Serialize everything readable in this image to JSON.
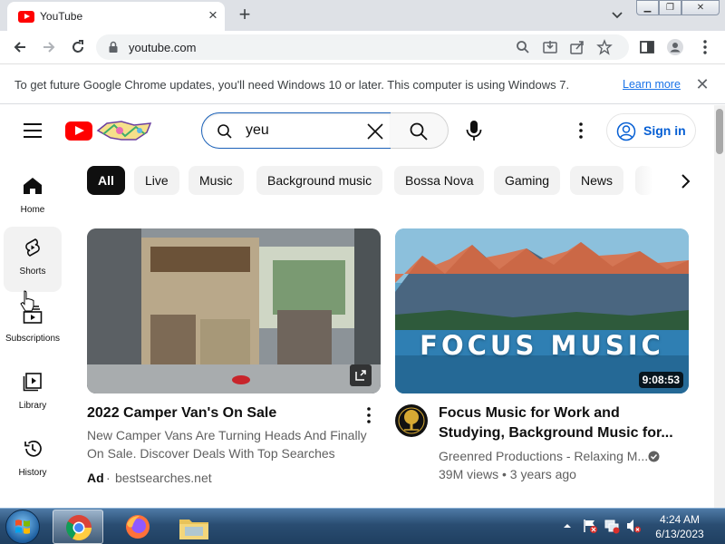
{
  "browser": {
    "tab_title": "YouTube",
    "url": "youtube.com",
    "infobar_message": "To get future Google Chrome updates, you'll need Windows 10 or later. This computer is using Windows 7.",
    "infobar_link": "Learn more"
  },
  "masthead": {
    "search_query": "yeu",
    "sign_in_label": "Sign in"
  },
  "chips": [
    "All",
    "Live",
    "Music",
    "Background music",
    "Bossa Nova",
    "Gaming",
    "News"
  ],
  "guide": [
    {
      "label": "Home",
      "icon": "home-icon"
    },
    {
      "label": "Shorts",
      "icon": "shorts-icon"
    },
    {
      "label": "Subscriptions",
      "icon": "subscriptions-icon"
    },
    {
      "label": "Library",
      "icon": "library-icon"
    },
    {
      "label": "History",
      "icon": "history-icon"
    }
  ],
  "videos": [
    {
      "title": "2022 Camper Van's On Sale",
      "description_line1": "New Camper Vans Are Turning Heads And Finally",
      "description_line2": "On Sale. Discover Deals With Top Searches",
      "ad_label": "Ad",
      "advertiser": "bestsearches.net"
    },
    {
      "title_line1": "Focus Music for Work and",
      "title_line2": "Studying, Background Music for...",
      "thumbnail_text": "FOCUS MUSIC",
      "duration": "9:08:53",
      "channel": "Greenred Productions - Relaxing M...",
      "meta": "39M views • 3 years ago"
    }
  ],
  "taskbar": {
    "time": "4:24 AM",
    "date": "6/13/2023"
  },
  "colors": {
    "youtube_red": "#ff0000",
    "link_blue": "#065fd4",
    "chrome_tab_bg": "#dee1e6",
    "taskbar": "#2a4d72"
  }
}
